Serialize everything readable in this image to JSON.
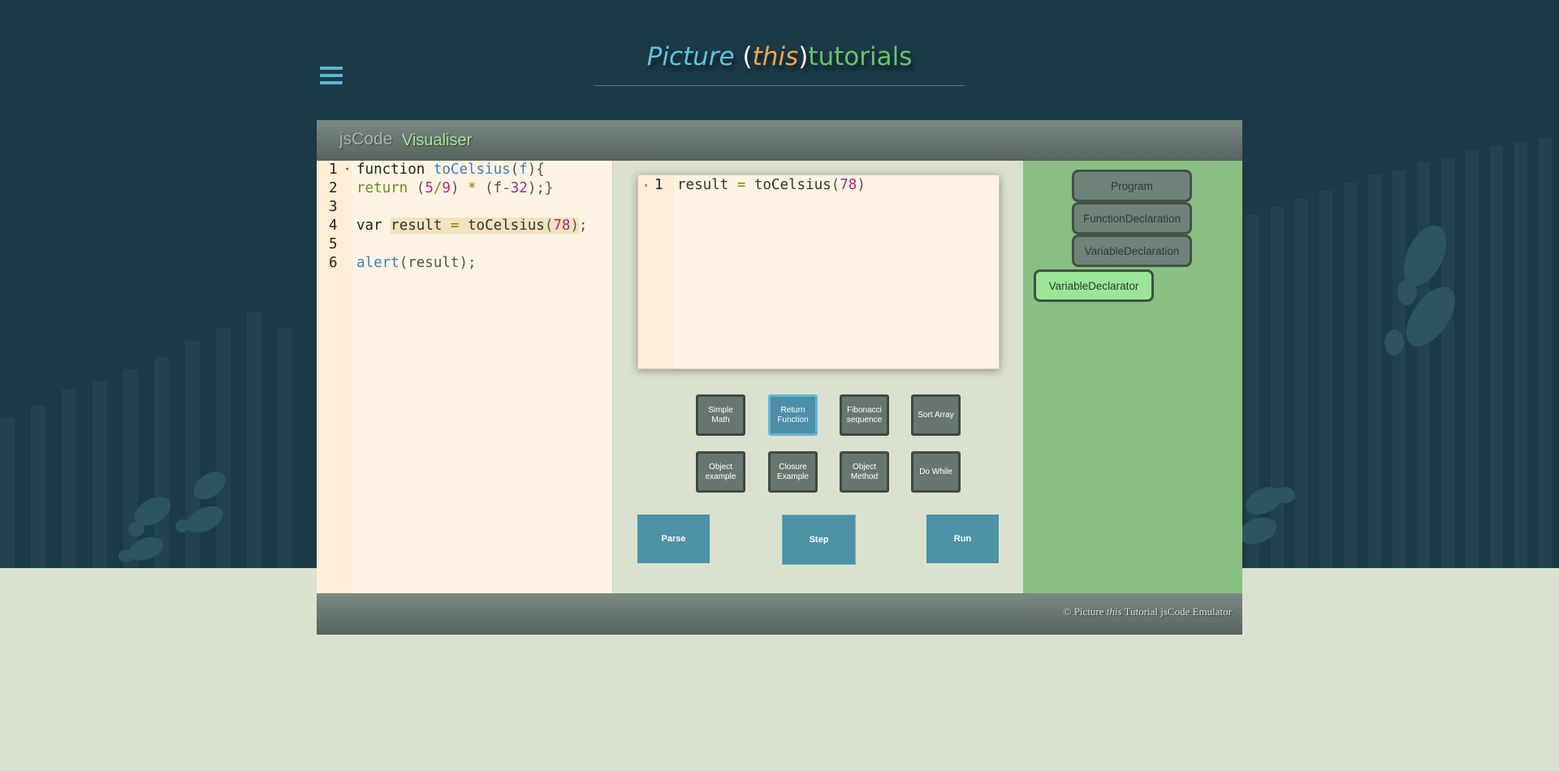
{
  "site": {
    "title_picture": "Picture",
    "title_open": "(",
    "title_this": "this",
    "title_close": ")",
    "title_tutorials": "tutorials"
  },
  "app": {
    "brand_jscode": "jsCode",
    "brand_visualiser": "Visualiser"
  },
  "editor": {
    "line_numbers": [
      "1",
      "2",
      "3",
      "4",
      "5",
      "6"
    ]
  },
  "popup": {
    "line_number": "1",
    "code": {
      "ident": "result",
      "eq": "=",
      "fn": "toCelsius",
      "open": "(",
      "num": "78",
      "close": ")"
    }
  },
  "examples": [
    {
      "label": "Simple Math"
    },
    {
      "label": "Return Function"
    },
    {
      "label": "Fibonacci sequence"
    },
    {
      "label": "Sort Array"
    },
    {
      "label": "Object example"
    },
    {
      "label": "Closure Example"
    },
    {
      "label": "Object Method"
    },
    {
      "label": "Do While"
    }
  ],
  "actions": {
    "parse": "Parse",
    "step": "Step",
    "run": "Run"
  },
  "tree": {
    "nodes": [
      "Program",
      "FunctionDeclaration",
      "VariableDeclaration",
      "VariableDeclarator"
    ],
    "active": "VariableDeclarator"
  },
  "footer": {
    "prefix": "© Picture",
    "this": "this",
    "suffix": "Tutorial jsCode Emulator"
  },
  "colors": {
    "background_dark": "#1b3a47",
    "background_light": "#dae2cf",
    "tree_panel": "#89bf80",
    "active_button": "#4c8fa8",
    "action_button": "#4e92a6"
  }
}
